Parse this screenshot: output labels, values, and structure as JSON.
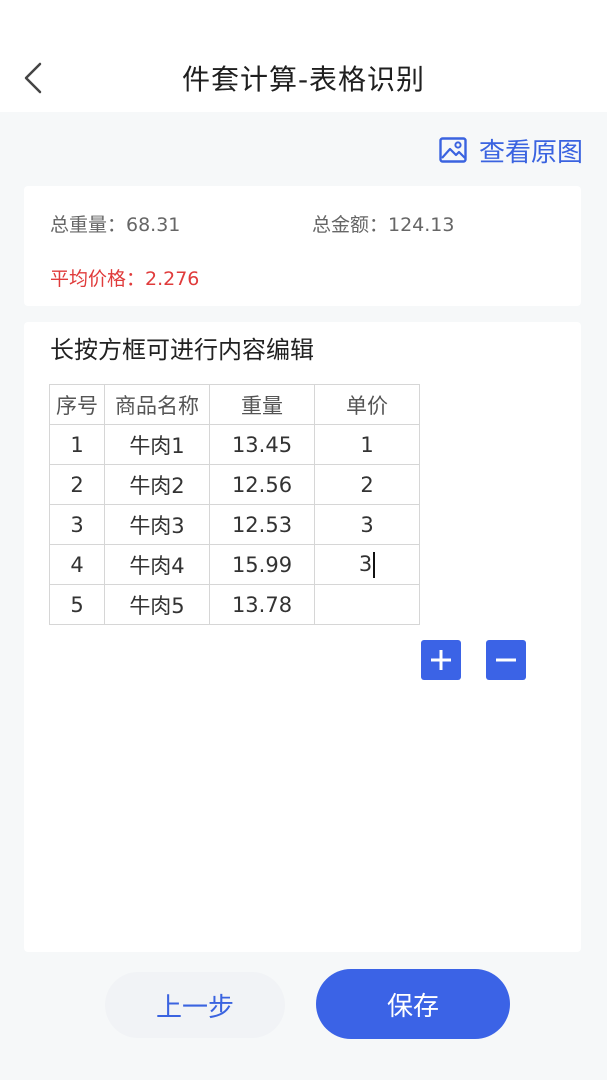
{
  "header": {
    "title": "件套计算-表格识别"
  },
  "toolbar": {
    "view_original_label": "查看原图"
  },
  "summary": {
    "total_weight": "总重量：68.31",
    "total_amount": "总金额：124.13",
    "average_price": "平均价格：2.276"
  },
  "editor": {
    "hint": "长按方框可进行内容编辑",
    "columns": [
      "序号",
      "商品名称",
      "重量",
      "单价"
    ],
    "rows": [
      [
        "1",
        "牛肉1",
        "13.45",
        "1"
      ],
      [
        "2",
        "牛肉2",
        "12.56",
        "2"
      ],
      [
        "3",
        "牛肉3",
        "12.53",
        "3"
      ],
      [
        "4",
        "牛肉4",
        "15.99",
        "3"
      ],
      [
        "5",
        "牛肉5",
        "13.78",
        ""
      ]
    ]
  },
  "footer": {
    "prev_label": "上一步",
    "save_label": "保存"
  },
  "colors": {
    "accent": "#3b63e6",
    "warning": "#e03b3b"
  }
}
